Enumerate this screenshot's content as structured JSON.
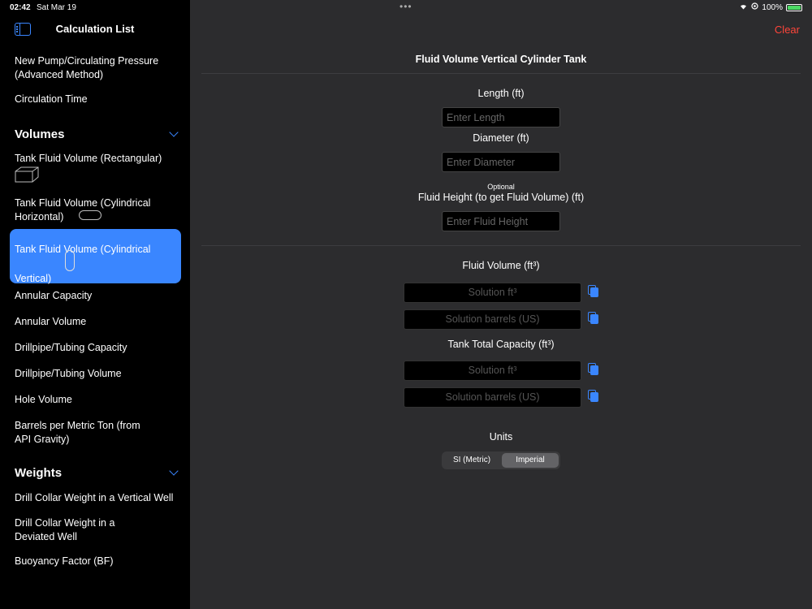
{
  "status": {
    "time": "02:42",
    "date": "Sat Mar 19",
    "battery": "100%"
  },
  "sidebar": {
    "title": "Calculation List",
    "items_top": [
      "New Pump/Circulating Pressure (Advanced Method)",
      "Circulation Time"
    ],
    "volumes": {
      "header": "Volumes",
      "items": [
        "Tank Fluid Volume (Rectangular)",
        "Tank Fluid Volume (Cylindrical Horizontal)",
        "Tank Fluid Volume (Cylindrical Vertical)",
        "Annular Capacity",
        "Annular Volume",
        "Drillpipe/Tubing Capacity",
        "Drillpipe/Tubing Volume",
        "Hole Volume",
        "Barrels per Metric Ton (from API Gravity)"
      ]
    },
    "weights": {
      "header": "Weights",
      "items": [
        "Drill Collar Weight in a Vertical Well",
        "Drill Collar Weight in a Deviated Well",
        "Buoyancy Factor (BF)"
      ]
    },
    "selected_index": 2
  },
  "main": {
    "clear_label": "Clear",
    "title": "Fluid Volume Vertical Cylinder Tank",
    "length_label": "Length (ft)",
    "length_placeholder": "Enter Length",
    "diameter_label": "Diameter (ft)",
    "diameter_placeholder": "Enter Diameter",
    "optional_label": "Optional",
    "height_label": "Fluid Height (to get Fluid Volume) (ft)",
    "height_placeholder": "Enter Fluid Height",
    "fluid_volume_label": "Fluid Volume (ft³)",
    "fluid_ft3": "Solution ft³",
    "fluid_bbl": "Solution barrels (US)",
    "tank_capacity_label": "Tank Total Capacity (ft³)",
    "tank_ft3": "Solution ft³",
    "tank_bbl": "Solution barrels (US)",
    "units_label": "Units",
    "units_options": [
      "SI (Metric)",
      "Imperial"
    ],
    "units_selected": "Imperial"
  },
  "colors": {
    "accent": "#3a86ff",
    "destructive": "#ff453a",
    "background": "#2c2c2e"
  }
}
